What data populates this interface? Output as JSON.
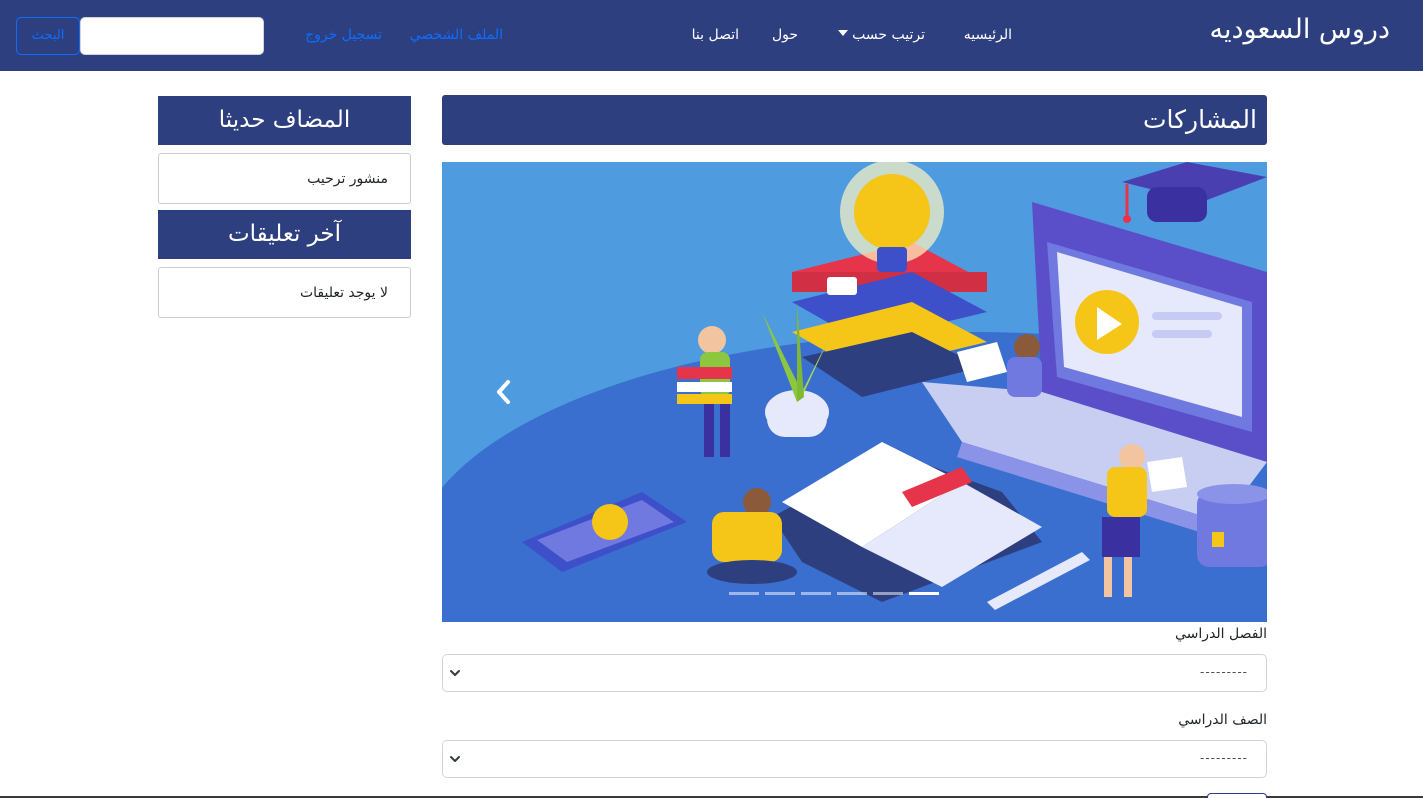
{
  "navbar": {
    "brand": "دروس السعوديه",
    "items": {
      "home": "الرئيسيه",
      "sort": "ترتيب حسب",
      "about": "حول",
      "contact": "اتصل بنا"
    },
    "links": {
      "profile": "الملف الشخصي",
      "logout": "تسجيل خروج"
    },
    "search": {
      "button": "البحث",
      "value": ""
    }
  },
  "sidebar": {
    "recent": {
      "title": "المضاف حديثا",
      "item": "منشور ترحيب"
    },
    "comments": {
      "title": "آخر تعليقات",
      "item": "لا يوجد تعليقات"
    }
  },
  "main": {
    "title": "المشاركات",
    "carousel": {
      "slide_count": 6,
      "active_index": 5
    },
    "form": {
      "semester": {
        "label": "الفصل الدراسي",
        "selected": "---------"
      },
      "grade": {
        "label": "الصف الدراسي",
        "selected": "---------"
      }
    }
  },
  "colors": {
    "primary": "#2e3f80",
    "link": "#0d6efd",
    "carousel_bg": "#4f9be0"
  }
}
